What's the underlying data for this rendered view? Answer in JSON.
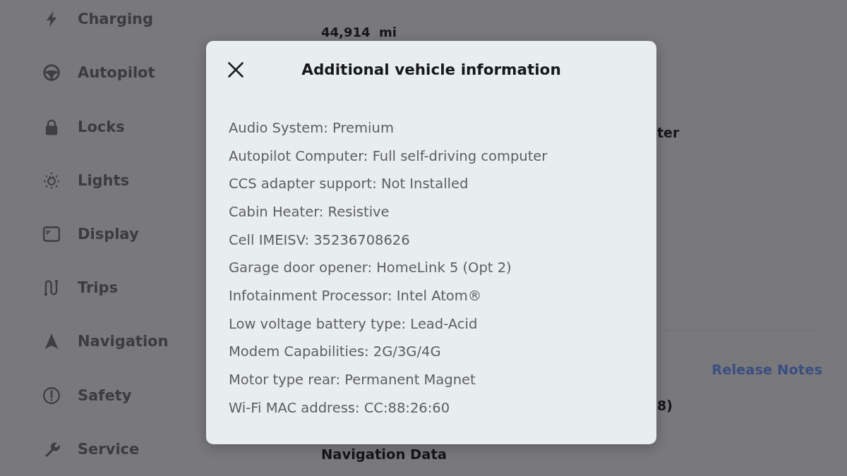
{
  "sidebar": {
    "items": [
      {
        "label": "Charging",
        "selected": false
      },
      {
        "label": "Autopilot",
        "selected": false
      },
      {
        "label": "Locks",
        "selected": false
      },
      {
        "label": "Lights",
        "selected": false
      },
      {
        "label": "Display",
        "selected": false
      },
      {
        "label": "Trips",
        "selected": false
      },
      {
        "label": "Navigation",
        "selected": false
      },
      {
        "label": "Safety",
        "selected": false
      },
      {
        "label": "Service",
        "selected": false
      }
    ]
  },
  "vehicle_details": {
    "odometer": "44,914  mi",
    "line_fragment": "ter"
  },
  "software": {
    "release_notes_link": "Release Notes",
    "version_fragment": "8)"
  },
  "navigation_data": {
    "title": "Navigation Data"
  },
  "modal": {
    "title": "Additional vehicle information",
    "rows": [
      "Audio System: Premium",
      "Autopilot Computer: Full self-driving computer",
      "CCS adapter support: Not Installed",
      "Cabin Heater: Resistive",
      "Cell IMEISV: 35236708626",
      "Garage door opener: HomeLink 5 (Opt 2)",
      "Infotainment Processor: Intel Atom®",
      "Low voltage battery type: Lead-Acid",
      "Modem Capabilities: 2G/3G/4G",
      "Motor type rear: Permanent Magnet",
      "Wi-Fi MAC address: CC:88:26:60"
    ]
  }
}
